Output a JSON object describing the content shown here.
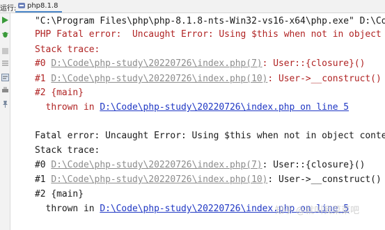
{
  "tabbar": {
    "run_label": "运行:",
    "tab_label": "php8.1.8"
  },
  "console": {
    "command": "\"C:\\Program Files\\php\\php-8.1.8-nts-Win32-vs16-x64\\php.exe\" D:\\Co",
    "block1": {
      "fatal": "PHP Fatal error:  Uncaught Error: Using $this when not in object",
      "stack_title": "Stack trace:",
      "t0_prefix": "#0 ",
      "t0_path": "D:\\Code\\php-study\\20220726\\index.php(7)",
      "t0_suffix": ": User::{closure}()",
      "t1_prefix": "#1 ",
      "t1_path": "D:\\Code\\php-study\\20220726\\index.php(10)",
      "t1_suffix": ": User->__construct()",
      "t2": "#2 {main}",
      "thrown_prefix": "  thrown in ",
      "thrown_link": "D:\\Code\\php-study\\20220726\\index.php on line 5"
    },
    "block2": {
      "fatal": "Fatal error: Uncaught Error: Using $this when not in object conte",
      "stack_title": "Stack trace:",
      "t0_prefix": "#0 ",
      "t0_path": "D:\\Code\\php-study\\20220726\\index.php(7)",
      "t0_suffix": ": User::{closure}()",
      "t1_prefix": "#1 ",
      "t1_path": "D:\\Code\\php-study\\20220726\\index.php(10)",
      "t1_suffix": ": User->__construct()",
      "t2": "#2 {main}",
      "thrown_prefix": "  thrown in ",
      "thrown_link": "D:\\Code\\php-study\\20220726\\index.php on line 5"
    }
  },
  "watermark": "知乎 @就叫我菜菜吧",
  "colors": {
    "error_red": "#b02323",
    "link_gray": "#8c8c8c",
    "link_blue": "#1f37c4",
    "run_green": "#3a9a3a"
  },
  "gutter_icons": [
    "run-icon",
    "bug-icon",
    "stop-icon",
    "scroll-to-end-icon",
    "soft-wrap-icon",
    "print-icon",
    "pin-icon"
  ]
}
